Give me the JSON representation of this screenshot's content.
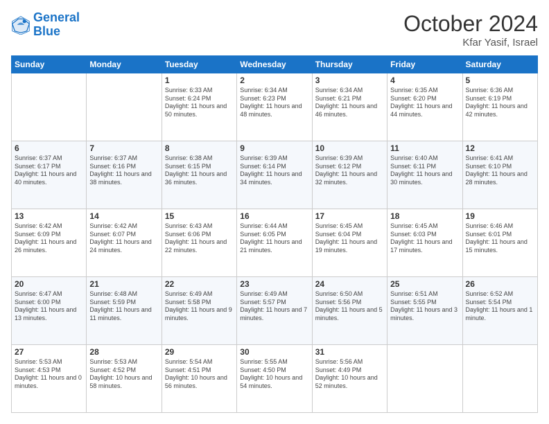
{
  "header": {
    "logo_line1": "General",
    "logo_line2": "Blue",
    "month": "October 2024",
    "location": "Kfar Yasif, Israel"
  },
  "days_of_week": [
    "Sunday",
    "Monday",
    "Tuesday",
    "Wednesday",
    "Thursday",
    "Friday",
    "Saturday"
  ],
  "weeks": [
    [
      {
        "day": "",
        "sunrise": "",
        "sunset": "",
        "daylight": ""
      },
      {
        "day": "",
        "sunrise": "",
        "sunset": "",
        "daylight": ""
      },
      {
        "day": "1",
        "sunrise": "Sunrise: 6:33 AM",
        "sunset": "Sunset: 6:24 PM",
        "daylight": "Daylight: 11 hours and 50 minutes."
      },
      {
        "day": "2",
        "sunrise": "Sunrise: 6:34 AM",
        "sunset": "Sunset: 6:23 PM",
        "daylight": "Daylight: 11 hours and 48 minutes."
      },
      {
        "day": "3",
        "sunrise": "Sunrise: 6:34 AM",
        "sunset": "Sunset: 6:21 PM",
        "daylight": "Daylight: 11 hours and 46 minutes."
      },
      {
        "day": "4",
        "sunrise": "Sunrise: 6:35 AM",
        "sunset": "Sunset: 6:20 PM",
        "daylight": "Daylight: 11 hours and 44 minutes."
      },
      {
        "day": "5",
        "sunrise": "Sunrise: 6:36 AM",
        "sunset": "Sunset: 6:19 PM",
        "daylight": "Daylight: 11 hours and 42 minutes."
      }
    ],
    [
      {
        "day": "6",
        "sunrise": "Sunrise: 6:37 AM",
        "sunset": "Sunset: 6:17 PM",
        "daylight": "Daylight: 11 hours and 40 minutes."
      },
      {
        "day": "7",
        "sunrise": "Sunrise: 6:37 AM",
        "sunset": "Sunset: 6:16 PM",
        "daylight": "Daylight: 11 hours and 38 minutes."
      },
      {
        "day": "8",
        "sunrise": "Sunrise: 6:38 AM",
        "sunset": "Sunset: 6:15 PM",
        "daylight": "Daylight: 11 hours and 36 minutes."
      },
      {
        "day": "9",
        "sunrise": "Sunrise: 6:39 AM",
        "sunset": "Sunset: 6:14 PM",
        "daylight": "Daylight: 11 hours and 34 minutes."
      },
      {
        "day": "10",
        "sunrise": "Sunrise: 6:39 AM",
        "sunset": "Sunset: 6:12 PM",
        "daylight": "Daylight: 11 hours and 32 minutes."
      },
      {
        "day": "11",
        "sunrise": "Sunrise: 6:40 AM",
        "sunset": "Sunset: 6:11 PM",
        "daylight": "Daylight: 11 hours and 30 minutes."
      },
      {
        "day": "12",
        "sunrise": "Sunrise: 6:41 AM",
        "sunset": "Sunset: 6:10 PM",
        "daylight": "Daylight: 11 hours and 28 minutes."
      }
    ],
    [
      {
        "day": "13",
        "sunrise": "Sunrise: 6:42 AM",
        "sunset": "Sunset: 6:09 PM",
        "daylight": "Daylight: 11 hours and 26 minutes."
      },
      {
        "day": "14",
        "sunrise": "Sunrise: 6:42 AM",
        "sunset": "Sunset: 6:07 PM",
        "daylight": "Daylight: 11 hours and 24 minutes."
      },
      {
        "day": "15",
        "sunrise": "Sunrise: 6:43 AM",
        "sunset": "Sunset: 6:06 PM",
        "daylight": "Daylight: 11 hours and 22 minutes."
      },
      {
        "day": "16",
        "sunrise": "Sunrise: 6:44 AM",
        "sunset": "Sunset: 6:05 PM",
        "daylight": "Daylight: 11 hours and 21 minutes."
      },
      {
        "day": "17",
        "sunrise": "Sunrise: 6:45 AM",
        "sunset": "Sunset: 6:04 PM",
        "daylight": "Daylight: 11 hours and 19 minutes."
      },
      {
        "day": "18",
        "sunrise": "Sunrise: 6:45 AM",
        "sunset": "Sunset: 6:03 PM",
        "daylight": "Daylight: 11 hours and 17 minutes."
      },
      {
        "day": "19",
        "sunrise": "Sunrise: 6:46 AM",
        "sunset": "Sunset: 6:01 PM",
        "daylight": "Daylight: 11 hours and 15 minutes."
      }
    ],
    [
      {
        "day": "20",
        "sunrise": "Sunrise: 6:47 AM",
        "sunset": "Sunset: 6:00 PM",
        "daylight": "Daylight: 11 hours and 13 minutes."
      },
      {
        "day": "21",
        "sunrise": "Sunrise: 6:48 AM",
        "sunset": "Sunset: 5:59 PM",
        "daylight": "Daylight: 11 hours and 11 minutes."
      },
      {
        "day": "22",
        "sunrise": "Sunrise: 6:49 AM",
        "sunset": "Sunset: 5:58 PM",
        "daylight": "Daylight: 11 hours and 9 minutes."
      },
      {
        "day": "23",
        "sunrise": "Sunrise: 6:49 AM",
        "sunset": "Sunset: 5:57 PM",
        "daylight": "Daylight: 11 hours and 7 minutes."
      },
      {
        "day": "24",
        "sunrise": "Sunrise: 6:50 AM",
        "sunset": "Sunset: 5:56 PM",
        "daylight": "Daylight: 11 hours and 5 minutes."
      },
      {
        "day": "25",
        "sunrise": "Sunrise: 6:51 AM",
        "sunset": "Sunset: 5:55 PM",
        "daylight": "Daylight: 11 hours and 3 minutes."
      },
      {
        "day": "26",
        "sunrise": "Sunrise: 6:52 AM",
        "sunset": "Sunset: 5:54 PM",
        "daylight": "Daylight: 11 hours and 1 minute."
      }
    ],
    [
      {
        "day": "27",
        "sunrise": "Sunrise: 5:53 AM",
        "sunset": "Sunset: 4:53 PM",
        "daylight": "Daylight: 11 hours and 0 minutes."
      },
      {
        "day": "28",
        "sunrise": "Sunrise: 5:53 AM",
        "sunset": "Sunset: 4:52 PM",
        "daylight": "Daylight: 10 hours and 58 minutes."
      },
      {
        "day": "29",
        "sunrise": "Sunrise: 5:54 AM",
        "sunset": "Sunset: 4:51 PM",
        "daylight": "Daylight: 10 hours and 56 minutes."
      },
      {
        "day": "30",
        "sunrise": "Sunrise: 5:55 AM",
        "sunset": "Sunset: 4:50 PM",
        "daylight": "Daylight: 10 hours and 54 minutes."
      },
      {
        "day": "31",
        "sunrise": "Sunrise: 5:56 AM",
        "sunset": "Sunset: 4:49 PM",
        "daylight": "Daylight: 10 hours and 52 minutes."
      },
      {
        "day": "",
        "sunrise": "",
        "sunset": "",
        "daylight": ""
      },
      {
        "day": "",
        "sunrise": "",
        "sunset": "",
        "daylight": ""
      }
    ]
  ]
}
